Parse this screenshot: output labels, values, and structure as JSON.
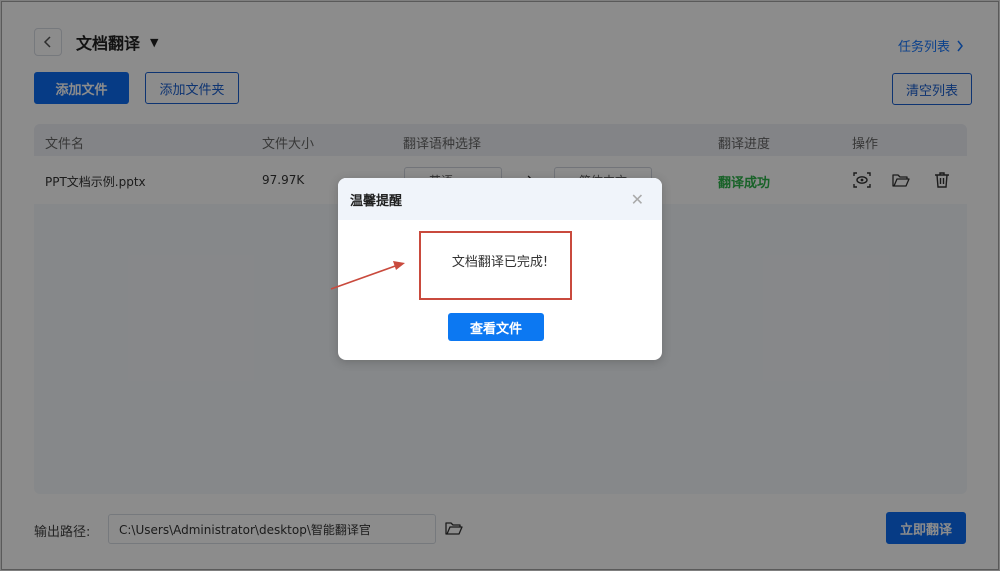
{
  "header": {
    "back_icon": "chevron-left-icon",
    "title": "文档翻译",
    "caret_icon": "caret-down-icon"
  },
  "task_list": {
    "label": "任务列表",
    "icon": "chevron-right-icon"
  },
  "toolbar": {
    "add_file": "添加文件",
    "add_folder": "添加文件夹",
    "clear_list": "清空列表"
  },
  "table": {
    "columns": [
      "文件名",
      "文件大小",
      "翻译语种选择",
      "翻译进度",
      "操作"
    ],
    "rows": [
      {
        "name": "PPT文档示例.pptx",
        "size": "97.97K",
        "source_lang": "英语",
        "target_lang": "简体中文",
        "status": "翻译成功"
      }
    ]
  },
  "footer": {
    "output_label": "输出路径:",
    "output_path": "C:\\Users\\Administrator\\desktop\\智能翻译官",
    "start_button": "立即翻译"
  },
  "dialog": {
    "title": "温馨提醒",
    "message": "文档翻译已完成!",
    "action": "查看文件"
  },
  "colors": {
    "primary": "#0c6cf2",
    "success": "#2db34a",
    "annotation": "#c94a3d"
  }
}
